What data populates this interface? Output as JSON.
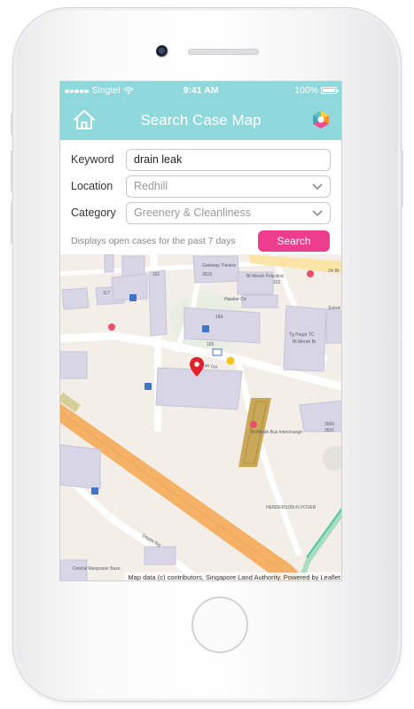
{
  "status_bar": {
    "carrier": "Singtel",
    "time": "9:41 AM",
    "battery": "100%"
  },
  "navbar": {
    "title": "Search Case Map",
    "home_icon": "home-icon",
    "logo_icon": "app-logo-icon"
  },
  "form": {
    "keyword_label": "Keyword",
    "keyword_value": "drain leak",
    "location_label": "Location",
    "location_value": "Redhill",
    "category_label": "Category",
    "category_value": "Greenery & Cleanliness",
    "info_text": "Displays open cases for the past 7 days",
    "search_label": "Search"
  },
  "map": {
    "labels": {
      "gateway_theatre": "Gateway Theatre",
      "blk_3615": "3615",
      "bt_merah_polyclinic": "Bt Merah Polyclinic",
      "hawker_ctr": "Hawker Ctr",
      "blk_162": "162",
      "blk_161": "161",
      "blk_117": "117",
      "blk_164": "164",
      "blk_165": "165",
      "tg_pagar_tc": "Tg Pagar TC",
      "bt_merah_br": "Bt Merah Br",
      "subuk": "Subuk",
      "bt_merah_ctrl": "Bt Merah Ctrl",
      "jln_bt": "Jln Bt",
      "bt_merah_bus_interchange": "Bt Merah Bus Interchange",
      "henderson_flyover": "HENDERSON FLYOVER",
      "depot_rd": "Depot Rd",
      "central_manpower_base": "Central Manpower Base",
      "blk_3500": "3500",
      "blk_3501": "3501"
    },
    "attribution": "Map data (c) contributors, Singapore Land Authority. Powered by Leaflet"
  },
  "colors": {
    "header": "#8fd9dc",
    "accent": "#ee3c8e",
    "marker": "#e0202a",
    "road_major": "#f5b266",
    "building": "#d8d6e6"
  }
}
